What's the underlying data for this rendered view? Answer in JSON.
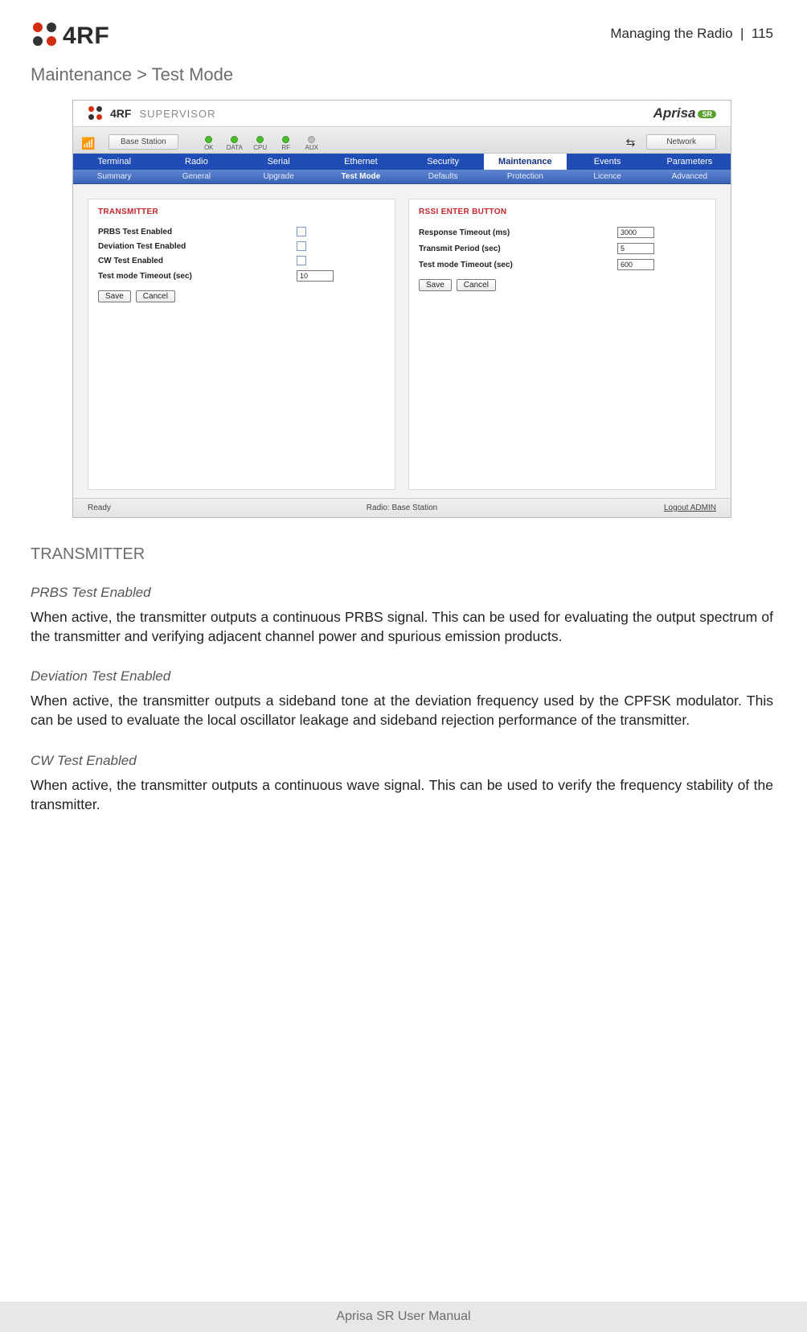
{
  "header": {
    "section": "Managing the Radio",
    "sep": "|",
    "page": "115",
    "logo_text": "4RF"
  },
  "title": "Maintenance > Test Mode",
  "supervisor": {
    "brand": "4RF",
    "word": "SUPERVISOR",
    "product": "Aprisa",
    "product_badge": "SR",
    "base_station": "Base Station",
    "network": "Network",
    "leds": [
      {
        "name": "OK",
        "on": true
      },
      {
        "name": "DATA",
        "on": true
      },
      {
        "name": "CPU",
        "on": true
      },
      {
        "name": "RF",
        "on": true
      },
      {
        "name": "AUX",
        "on": false
      }
    ],
    "tabs1": [
      "Terminal",
      "Radio",
      "Serial",
      "Ethernet",
      "Security",
      "Maintenance",
      "Events",
      "Parameters"
    ],
    "tabs1_active": "Maintenance",
    "tabs2": [
      "Summary",
      "General",
      "Upgrade",
      "Test Mode",
      "Defaults",
      "Protection",
      "Licence",
      "Advanced"
    ],
    "tabs2_active": "Test Mode",
    "transmitter": {
      "title": "TRANSMITTER",
      "rows": [
        {
          "label": "PRBS Test Enabled",
          "type": "check"
        },
        {
          "label": "Deviation Test Enabled",
          "type": "check"
        },
        {
          "label": "CW Test Enabled",
          "type": "check"
        },
        {
          "label": "Test mode Timeout (sec)",
          "type": "text",
          "value": "10"
        }
      ],
      "save": "Save",
      "cancel": "Cancel"
    },
    "rssi": {
      "title": "RSSI ENTER BUTTON",
      "rows": [
        {
          "label": "Response Timeout (ms)",
          "value": "3000"
        },
        {
          "label": "Transmit Period (sec)",
          "value": "5"
        },
        {
          "label": "Test mode Timeout (sec)",
          "value": "600"
        }
      ],
      "save": "Save",
      "cancel": "Cancel"
    },
    "footer": {
      "left": "Ready",
      "mid": "Radio: Base Station",
      "right": "Logout ADMIN"
    }
  },
  "sections": {
    "h2": "TRANSMITTER",
    "s1": {
      "h": "PRBS Test Enabled",
      "p": "When active, the transmitter outputs a continuous PRBS signal. This can be used for evaluating the output spectrum of the transmitter and verifying adjacent channel power and spurious emission products."
    },
    "s2": {
      "h": "Deviation Test Enabled",
      "p": "When active, the transmitter outputs a sideband tone at the deviation frequency used by the CPFSK modulator. This can be used to evaluate the local oscillator leakage and sideband rejection performance of the transmitter."
    },
    "s3": {
      "h": "CW Test Enabled",
      "p": "When active, the transmitter outputs a continuous wave signal. This can be used to verify the frequency stability of the transmitter."
    }
  },
  "footer": "Aprisa SR User Manual"
}
